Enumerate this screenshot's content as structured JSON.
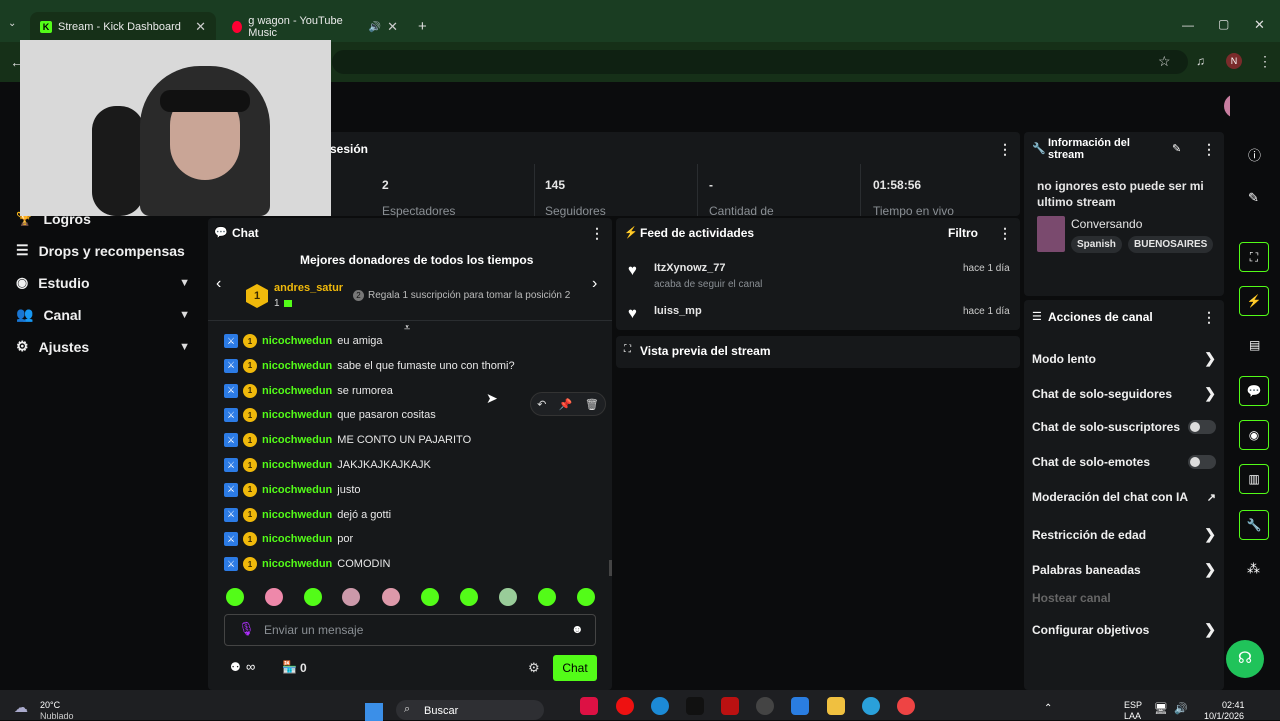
{
  "browser": {
    "tabs": [
      {
        "label": "Stream - Kick Dashboard",
        "active": true
      },
      {
        "label": "g wagon - YouTube Music",
        "active": false
      }
    ],
    "profile_initial": "N"
  },
  "sidebar": {
    "items": [
      {
        "label": "Logros",
        "icon": "trophy-icon"
      },
      {
        "label": "Drops y recompensas",
        "icon": "list-icon"
      },
      {
        "label": "Estudio",
        "icon": "camera-icon"
      },
      {
        "label": "Canal",
        "icon": "users-icon"
      },
      {
        "label": "Ajustes",
        "icon": "gear-icon"
      }
    ]
  },
  "session": {
    "title": "sesión",
    "stats": [
      {
        "value": "2",
        "label": "Espectadores"
      },
      {
        "value": "145",
        "label": "Seguidores"
      },
      {
        "value": "-",
        "label": "Cantidad de"
      },
      {
        "value": "01:58:56",
        "label": "Tiempo en vivo"
      }
    ]
  },
  "chat": {
    "title": "Chat",
    "donors_title": "Mejores donadores de todos los tiempos",
    "top_donor": {
      "name": "andres_satur",
      "rank": "1",
      "count": "1"
    },
    "gift_hint": "Regala 1 suscripción para tomar la posición 2",
    "gift_rank": "2",
    "messages": [
      {
        "user": "nicochwedun",
        "text": "eu amiga"
      },
      {
        "user": "nicochwedun",
        "text": "sabe el que fumaste uno con thomi?"
      },
      {
        "user": "nicochwedun",
        "text": "se rumorea"
      },
      {
        "user": "nicochwedun",
        "text": "que pasaron cositas"
      },
      {
        "user": "nicochwedun",
        "text": "ME CONTO UN PAJARITO"
      },
      {
        "user": "nicochwedun",
        "text": "JAKJKAJKAJKAJK"
      },
      {
        "user": "nicochwedun",
        "text": "justo"
      },
      {
        "user": "nicochwedun",
        "text": "dejó a gotti"
      },
      {
        "user": "nicochwedun",
        "text": "por"
      },
      {
        "user": "nicochwedun",
        "text": "COMODIN"
      }
    ],
    "input_placeholder": "Enviar un mensaje",
    "send_label": "Chat",
    "points_count": "0",
    "infinity": "∞"
  },
  "activity": {
    "title": "Feed de actividades",
    "filter_label": "Filtro",
    "items": [
      {
        "user": "ItzXynowz_77",
        "detail": "acaba de seguir el canal",
        "time": "hace 1 día"
      },
      {
        "user": "luiss_mp",
        "detail": "",
        "time": "hace 1 día"
      }
    ]
  },
  "preview": {
    "title": "Vista previa del stream"
  },
  "stream_info": {
    "title": "Información del stream",
    "stream_title": "no ignores esto puede ser mi ultimo stream",
    "category": "Conversando",
    "tags": [
      "Spanish",
      "BUENOSAIRES"
    ]
  },
  "channel_actions": {
    "title": "Acciones de canal",
    "items": [
      {
        "label": "Modo lento",
        "control": "chevron"
      },
      {
        "label": "Chat de solo-seguidores",
        "control": "chevron"
      },
      {
        "label": "Chat de solo-suscriptores",
        "control": "toggle",
        "on": false
      },
      {
        "label": "Chat de solo-emotes",
        "control": "toggle",
        "on": false
      },
      {
        "label": "Moderación del chat con IA",
        "control": "external"
      },
      {
        "label": "Restricción de edad",
        "control": "chevron"
      },
      {
        "label": "Palabras baneadas",
        "control": "chevron"
      },
      {
        "label": "Hostear canal",
        "control": "none",
        "disabled": true
      },
      {
        "label": "Configurar objetivos",
        "control": "chevron"
      }
    ]
  },
  "taskbar": {
    "weather_temp": "20°C",
    "weather_desc": "Nublado",
    "search_placeholder": "Buscar",
    "lang": "ESP",
    "lang_sub": "LAA",
    "time": "02:41",
    "date": "10/1/2026"
  },
  "colors": {
    "accent": "#53fc18",
    "panel": "#16181a",
    "bg": "#0b0c0d"
  }
}
